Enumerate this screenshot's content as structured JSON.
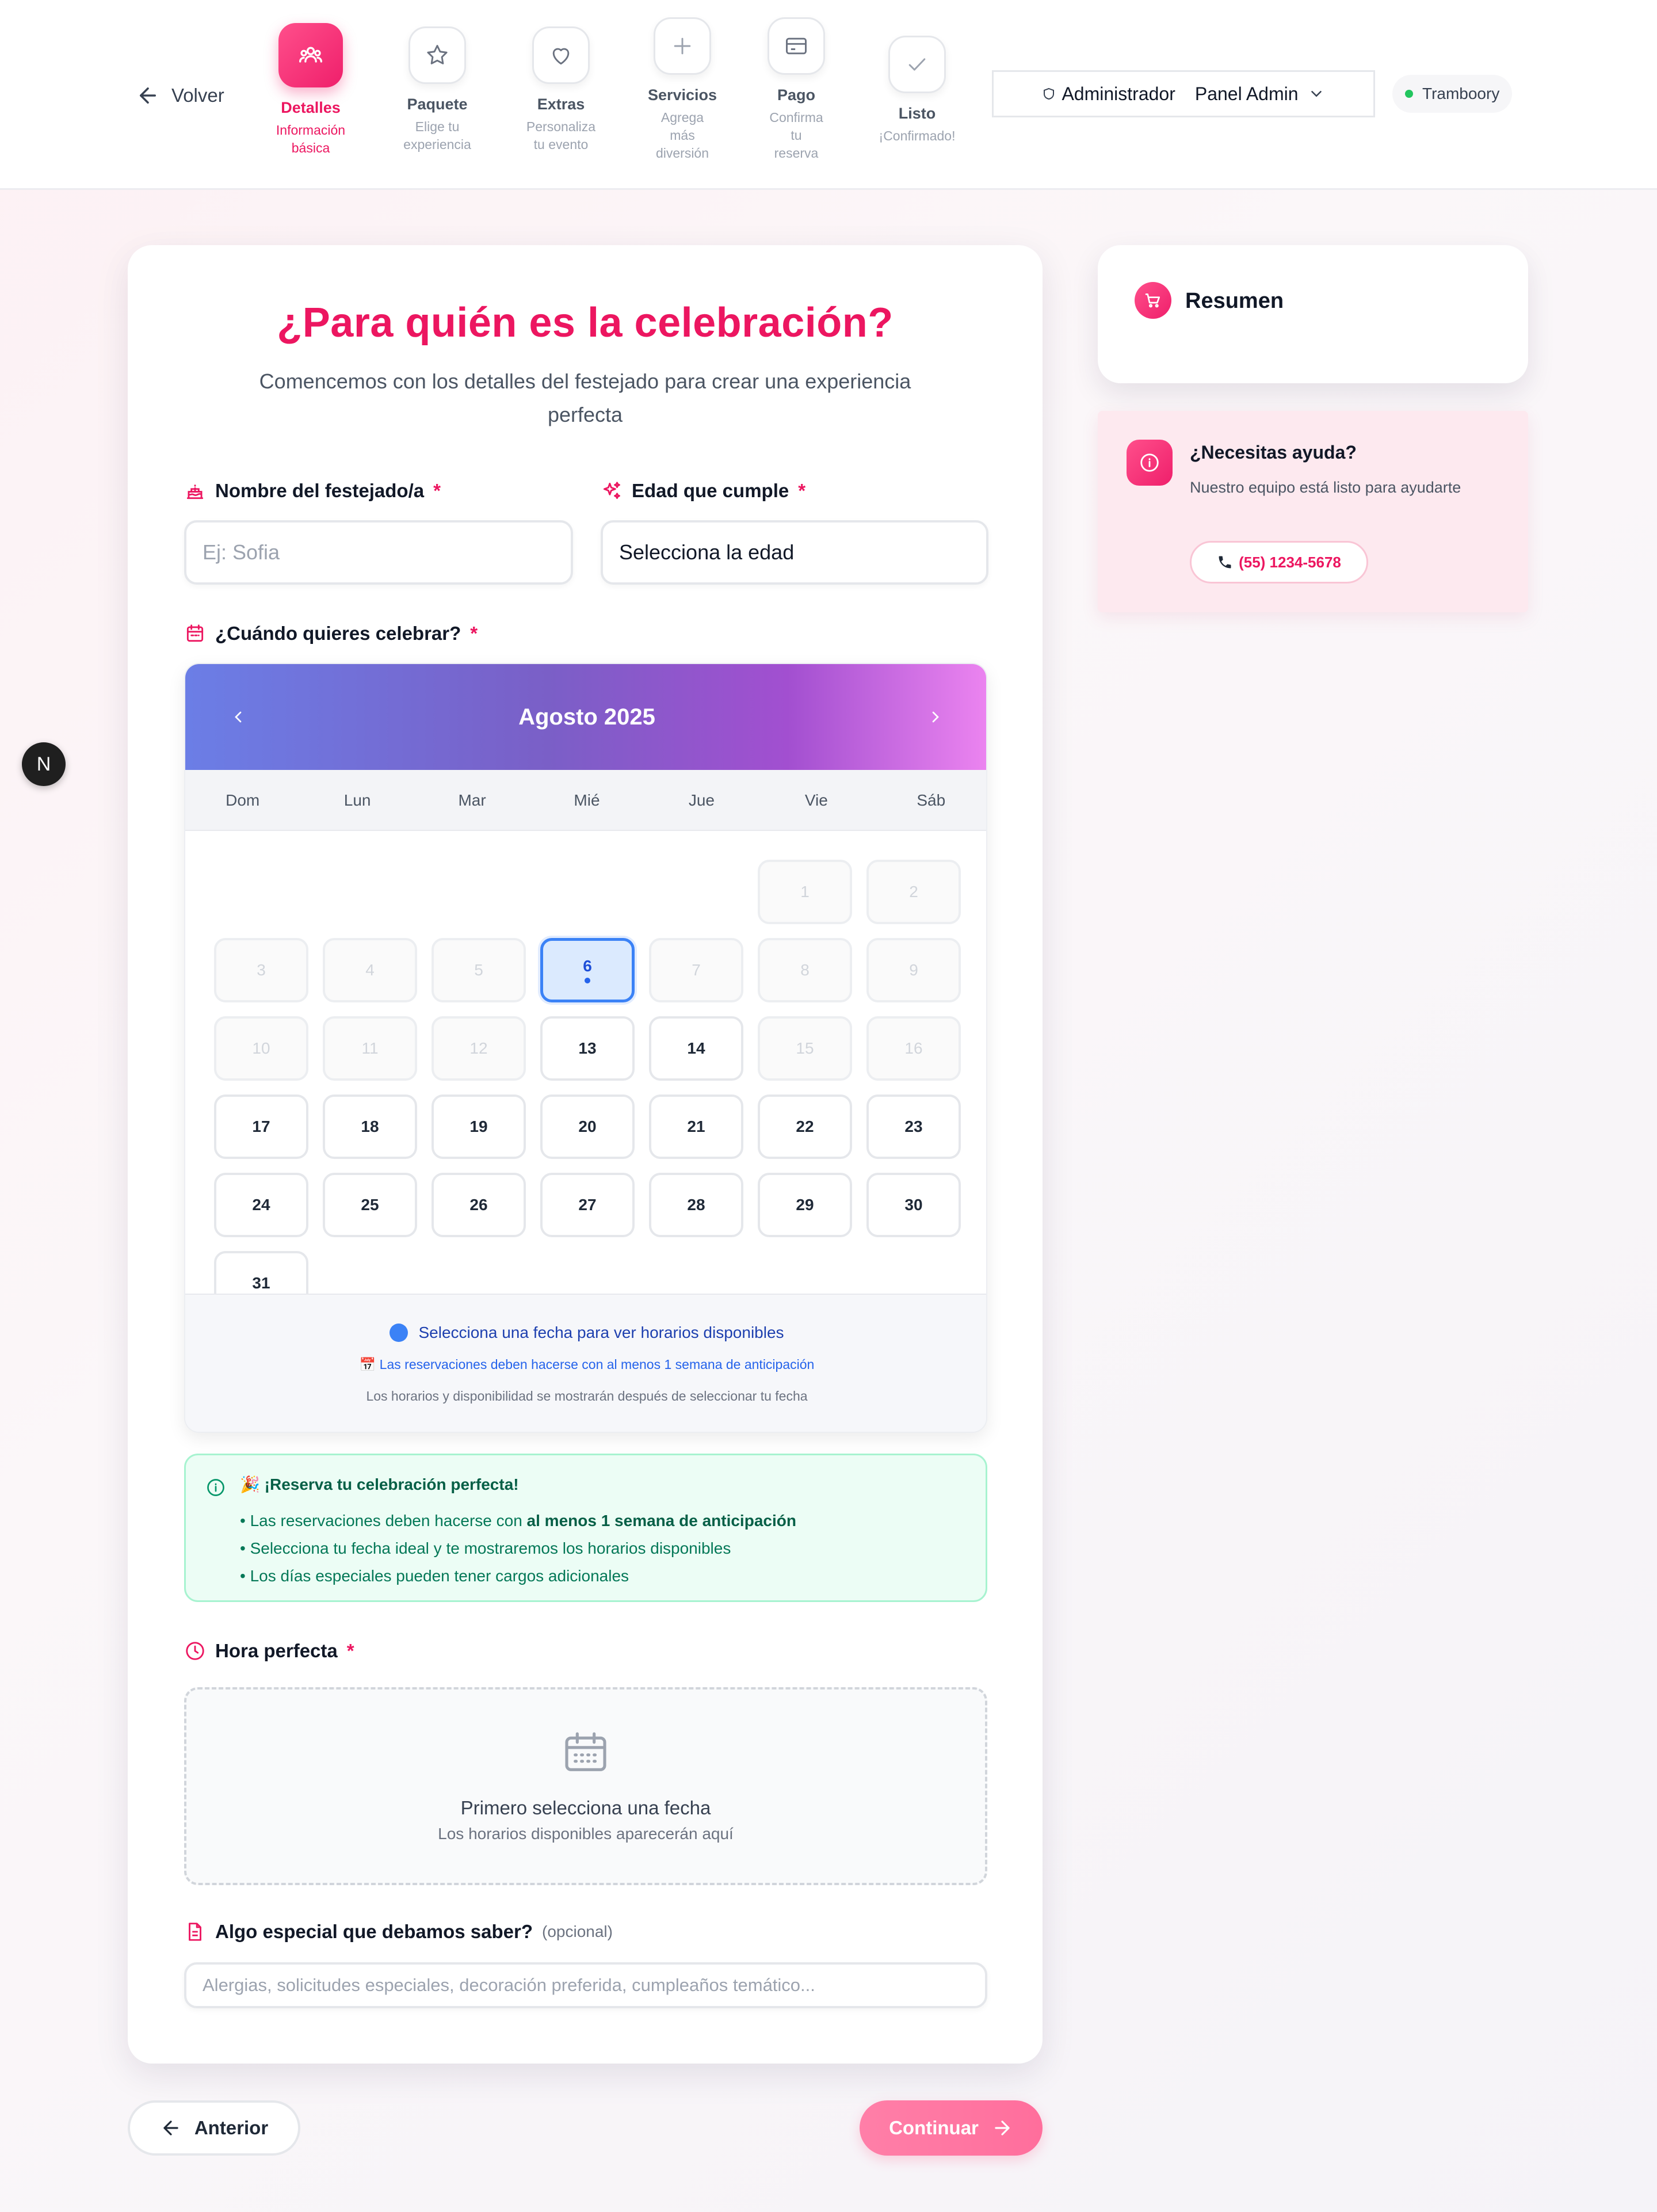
{
  "header": {
    "back_label": "Volver",
    "steps": [
      {
        "title": "Detalles",
        "sub1": "Información",
        "sub2": "básica",
        "sub3": "",
        "icon": "users-icon"
      },
      {
        "title": "Paquete",
        "sub1": "Elige tu",
        "sub2": "experiencia",
        "sub3": "",
        "icon": "star-icon"
      },
      {
        "title": "Extras",
        "sub1": "Personaliza",
        "sub2": "tu evento",
        "sub3": "",
        "icon": "heart-icon"
      },
      {
        "title": "Servicios",
        "sub1": "Agrega",
        "sub2": "más",
        "sub3": "diversión",
        "icon": "plus-icon"
      },
      {
        "title": "Pago",
        "sub1": "Confirma",
        "sub2": "tu",
        "sub3": "reserva",
        "icon": "credit-card-icon"
      },
      {
        "title": "Listo",
        "sub1": "¡Confirmado!",
        "sub2": "",
        "sub3": "",
        "icon": "check-icon"
      }
    ],
    "admin_role": "Administrador",
    "admin_panel": "Panel Admin",
    "brand": "Tramboory"
  },
  "form": {
    "title": "¿Para quién es la celebración?",
    "subtitle_line1": "Comencemos con los detalles del festejado para crear una experiencia",
    "subtitle_line2": "perfecta",
    "name_label": "Nombre del festejado/a",
    "name_placeholder": "Ej: Sofia",
    "age_label": "Edad que cumple",
    "age_value": "Selecciona la edad",
    "date_label": "¿Cuándo quieres celebrar?",
    "required_mark": "*",
    "time_label": "Hora perfecta",
    "notes_label": "Algo especial que debamos saber?",
    "notes_optional": "(opcional)",
    "notes_placeholder": "Alergias, solicitudes especiales, decoración preferida, cumpleaños temático..."
  },
  "calendar": {
    "month": "Agosto 2025",
    "weekdays": [
      "Dom",
      "Lun",
      "Mar",
      "Mié",
      "Jue",
      "Vie",
      "Sáb"
    ],
    "first_weekday": 5,
    "days_in_month": 31,
    "disabled_days": [
      1,
      2,
      3,
      4,
      5,
      7,
      8,
      9,
      10,
      11,
      12,
      15,
      16
    ],
    "selected_day": 6,
    "footer_main": "Selecciona una fecha para ver horarios disponibles",
    "footer_note": "📅 Las reservaciones deben hacerse con al menos 1 semana de anticipación",
    "footer_small": "Los horarios y disponibilidad se mostrarán después de seleccionar tu fecha"
  },
  "info": {
    "heading": "🎉 ¡Reserva tu celebración perfecta!",
    "b1_pre": "• Las reservaciones deben hacerse con ",
    "b1_bold": "al menos 1 semana de anticipación",
    "b2": "• Selecciona tu fecha ideal y te mostraremos los horarios disponibles",
    "b3": "• Los días especiales pueden tener cargos adicionales"
  },
  "time_placeholder": {
    "title": "Primero selecciona una fecha",
    "sub": "Los horarios disponibles aparecerán aquí"
  },
  "nav": {
    "prev_label": "Anterior",
    "next_label": "Continuar"
  },
  "sidebar": {
    "summary_title": "Resumen",
    "help_title": "¿Necesitas ayuda?",
    "help_text": "Nuestro equipo está listo para ayudarte",
    "help_phone": "(55) 1234-5678"
  },
  "floating_badge": "N",
  "colors": {
    "accent": "#ec1660",
    "selected_day": "#3b82f6",
    "success_text": "#047857"
  }
}
